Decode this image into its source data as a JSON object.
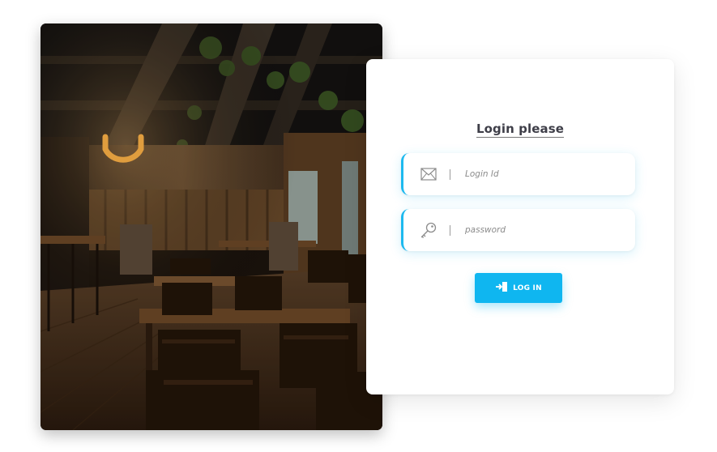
{
  "login": {
    "title": "Login please",
    "login_id": {
      "placeholder": "Login Id",
      "value": "",
      "icon": "envelope-icon"
    },
    "password": {
      "placeholder": "password",
      "value": "",
      "icon": "key-icon"
    },
    "button": {
      "label": "LOG IN",
      "icon": "login-icon"
    }
  },
  "colors": {
    "accent": "#0fb6f0",
    "title_text": "#3e3e48",
    "card_background": "#ffffff"
  }
}
